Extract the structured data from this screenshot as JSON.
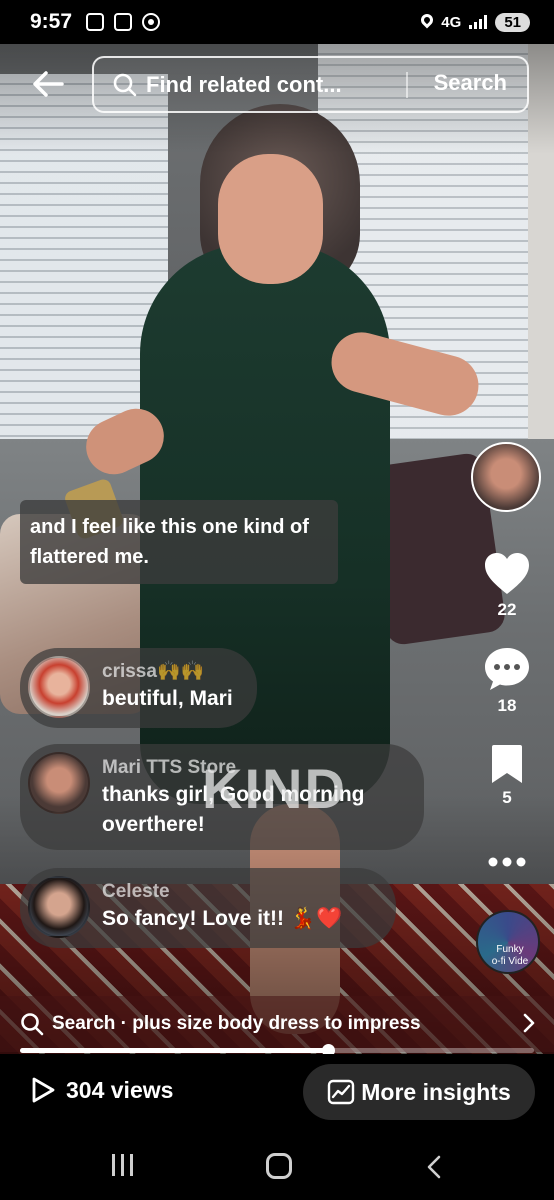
{
  "status_bar": {
    "time": "9:57",
    "network": "4G",
    "battery": "51"
  },
  "header": {
    "search_placeholder": "Find related cont...",
    "search_button": "Search",
    "back_icon": "arrow-left-icon"
  },
  "caption": {
    "text": "and I feel like this one kind of flattered me."
  },
  "comments": [
    {
      "author": "crissa",
      "author_emoji": "🙌🙌",
      "text": "beutiful, Mari"
    },
    {
      "author": "Mari TTS Store",
      "text": "thanks girl, Good morning overthere!"
    },
    {
      "author": "Celeste",
      "text": "So fancy! Love it!! 💃❤️"
    }
  ],
  "overlay_text": "KIND",
  "actions": {
    "likes": "22",
    "comments": "18",
    "saves": "5"
  },
  "music": {
    "label_line1": "Funky",
    "label_line2": "o-fi Vide"
  },
  "suggestion": {
    "text": "Search · plus size body dress to impress"
  },
  "playback": {
    "progress_fraction": 0.6
  },
  "bottom": {
    "views": "304 views",
    "insights_button": "More insights"
  },
  "colors": {
    "dress": "#1d3b30",
    "like_heart": "#ffffff",
    "suggest_bar": "#461414"
  }
}
